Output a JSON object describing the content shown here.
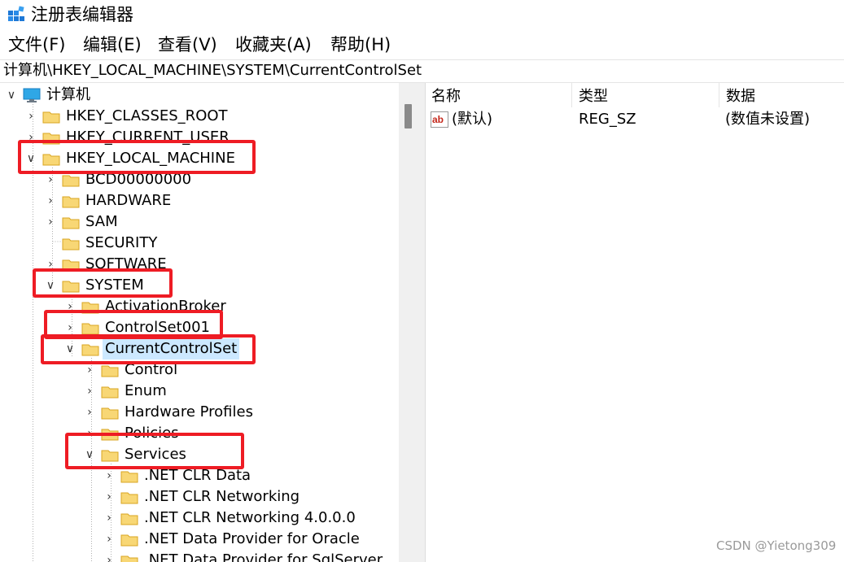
{
  "window": {
    "title": "注册表编辑器",
    "app_icon": "regedit-icon"
  },
  "menu": [
    {
      "label": "文件(F)"
    },
    {
      "label": "编辑(E)"
    },
    {
      "label": "查看(V)"
    },
    {
      "label": "收藏夹(A)"
    },
    {
      "label": "帮助(H)"
    }
  ],
  "address": "计算机\\HKEY_LOCAL_MACHINE\\SYSTEM\\CurrentControlSet",
  "tree": {
    "root": "计算机",
    "items": [
      {
        "label": "HKEY_CLASSES_ROOT"
      },
      {
        "label": "HKEY_CURRENT_USER"
      },
      {
        "label": "HKEY_LOCAL_MACHINE"
      },
      {
        "label": "BCD00000000"
      },
      {
        "label": "HARDWARE"
      },
      {
        "label": "SAM"
      },
      {
        "label": "SECURITY"
      },
      {
        "label": "SOFTWARE"
      },
      {
        "label": "SYSTEM"
      },
      {
        "label": "ActivationBroker"
      },
      {
        "label": "ControlSet001"
      },
      {
        "label": "CurrentControlSet"
      },
      {
        "label": "Control"
      },
      {
        "label": "Enum"
      },
      {
        "label": "Hardware Profiles"
      },
      {
        "label": "Policies"
      },
      {
        "label": "Services"
      },
      {
        "label": ".NET CLR Data"
      },
      {
        "label": ".NET CLR Networking"
      },
      {
        "label": ".NET CLR Networking 4.0.0.0"
      },
      {
        "label": ".NET Data Provider for Oracle"
      },
      {
        "label": ".NET Data Provider for SqlServer"
      }
    ]
  },
  "list": {
    "columns": [
      "名称",
      "类型",
      "数据"
    ],
    "rows": [
      {
        "name": "(默认)",
        "type": "REG_SZ",
        "data": "(数值未设置)",
        "icon": "string-value-icon"
      }
    ]
  },
  "watermark": "CSDN @Yietong309",
  "colors": {
    "highlight_box": "#ee1c24",
    "selection": "#cce8ff",
    "folder": "#f8d775"
  }
}
